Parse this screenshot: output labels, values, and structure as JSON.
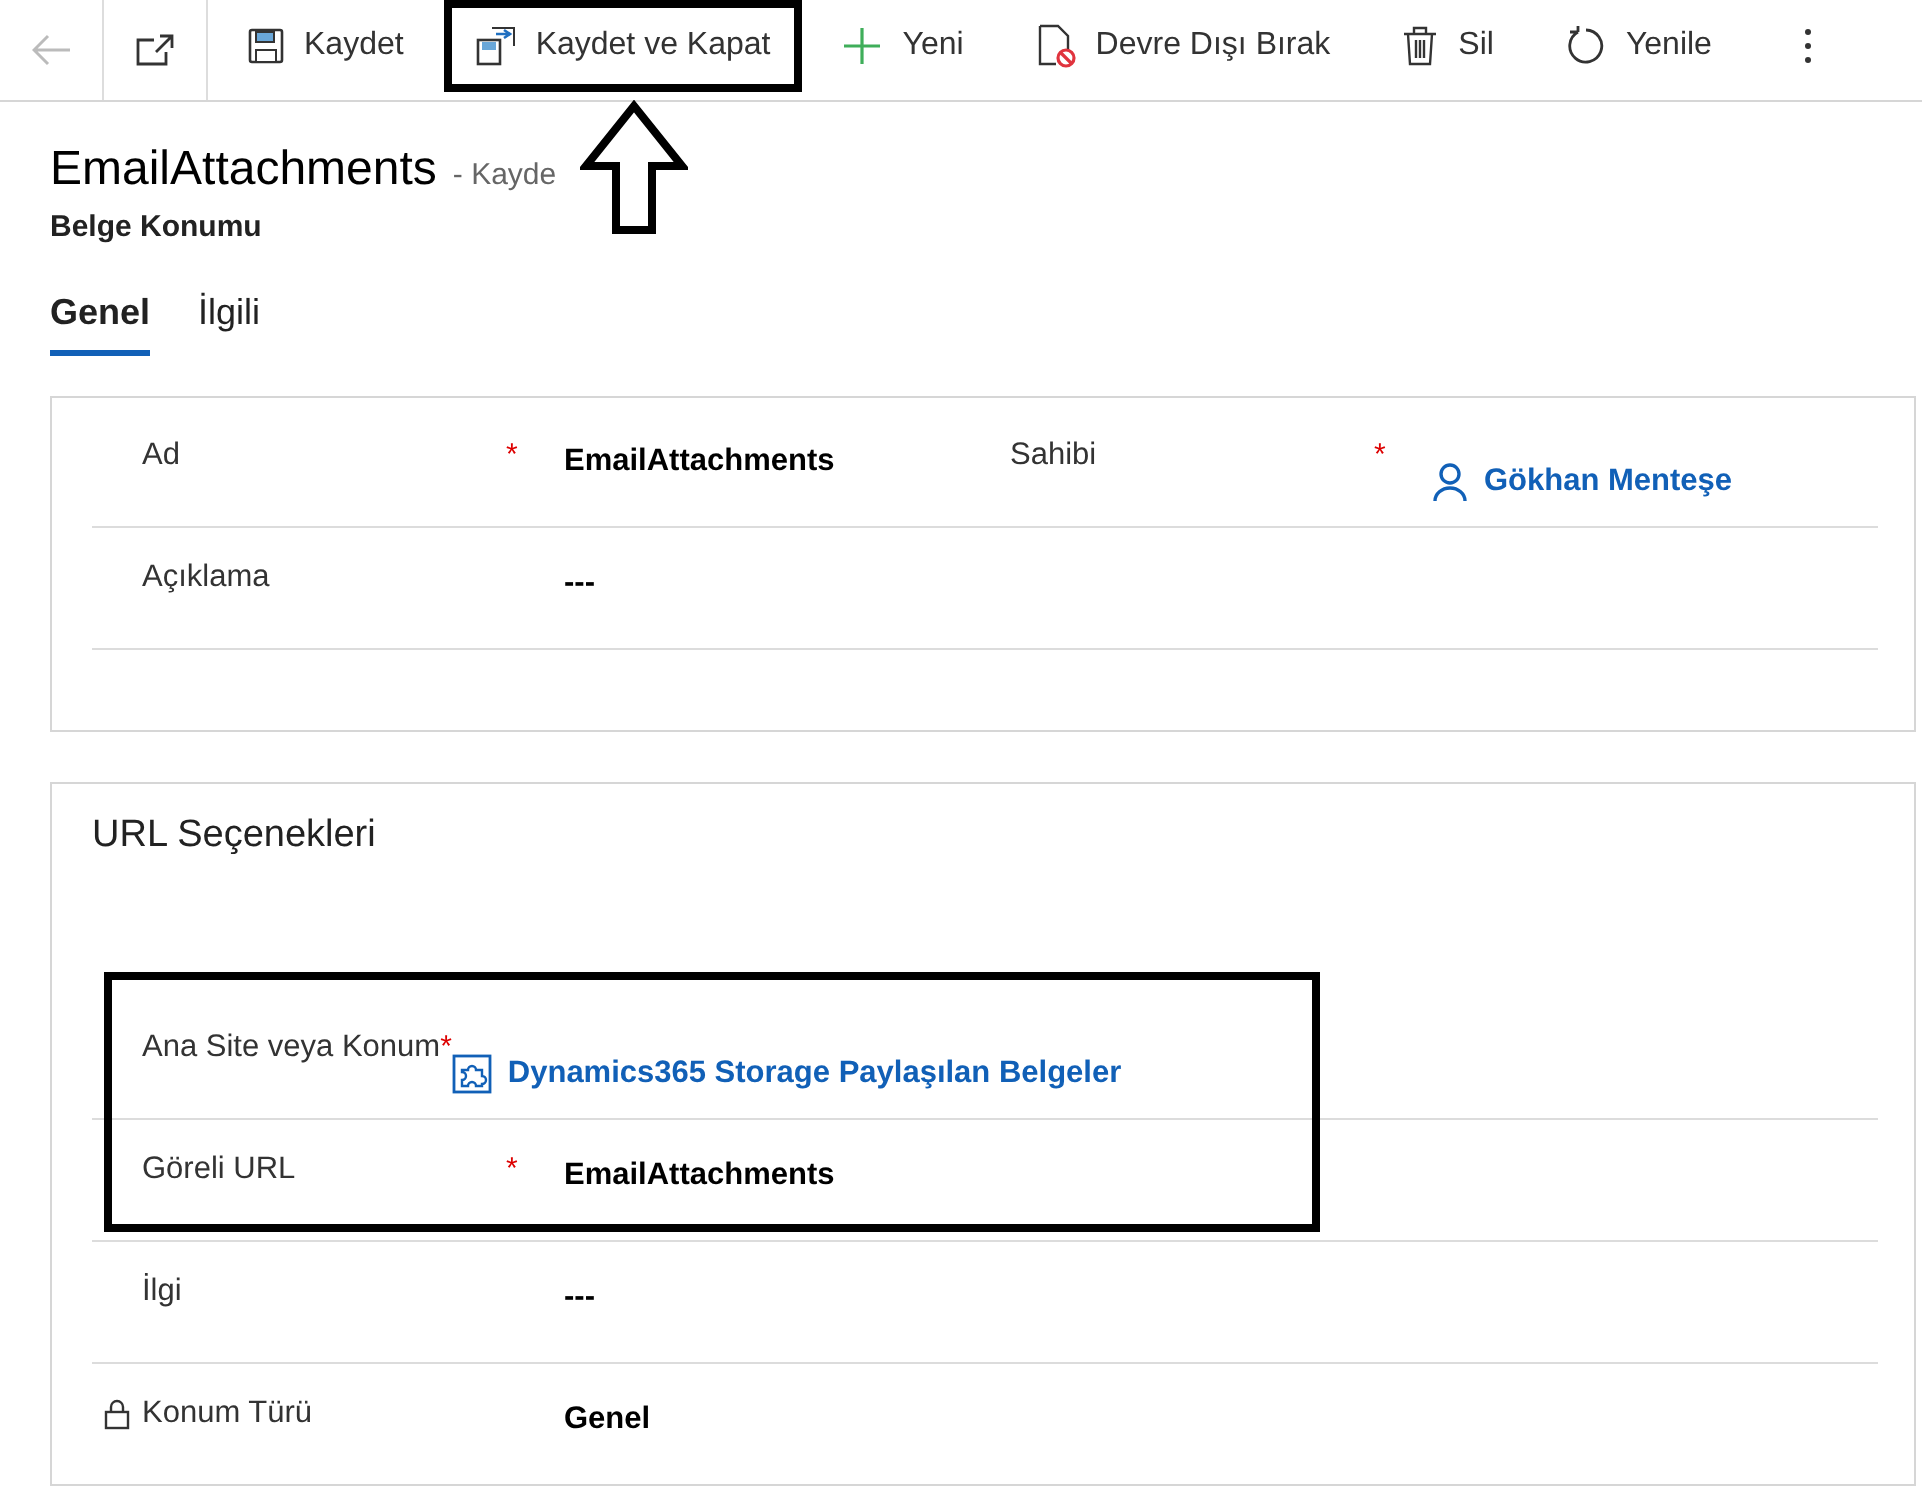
{
  "toolbar": [
    {
      "kind": "back",
      "disabled": true,
      "highlighted": false
    },
    {
      "kind": "popout",
      "disabled": false,
      "highlighted": false
    },
    {
      "kind": "save",
      "label": "Kaydet",
      "disabled": false,
      "highlighted": false
    },
    {
      "kind": "save-close",
      "label": "Kaydet ve Kapat",
      "disabled": false,
      "highlighted": true
    },
    {
      "kind": "new",
      "label": "Yeni",
      "disabled": false,
      "highlighted": false
    },
    {
      "kind": "deactivate",
      "label": "Devre Dışı Bırak",
      "disabled": false,
      "highlighted": false
    },
    {
      "kind": "delete",
      "label": "Sil",
      "disabled": false,
      "highlighted": false
    },
    {
      "kind": "refresh",
      "label": "Yenile",
      "disabled": false,
      "highlighted": false
    },
    {
      "kind": "more",
      "disabled": false,
      "highlighted": false
    }
  ],
  "record": {
    "title": "EmailAttachments",
    "status": "- Kayde",
    "entity": "Belge Konumu"
  },
  "tabs": [
    {
      "label": "Genel",
      "selected": true
    },
    {
      "label": "İlgili",
      "selected": false
    }
  ],
  "sections": [
    {
      "rows": [
        {
          "highlighted": false,
          "fields": [
            {
              "label": "Ad",
              "required": true,
              "required_mark": "*",
              "locked": false,
              "value": "EmailAttachments",
              "kind": "text"
            },
            {
              "label": "Sahibi",
              "required": true,
              "required_mark": "*",
              "locked": false,
              "value": "Gökhan Menteşe",
              "kind": "user-link"
            }
          ]
        },
        {
          "highlighted": false,
          "fields": [
            {
              "label": "Açıklama",
              "required": false,
              "locked": false,
              "value": "---",
              "kind": "text"
            }
          ]
        }
      ]
    },
    {
      "title": "URL Seçenekleri",
      "rows": [
        {
          "highlighted": true,
          "fields": [
            {
              "label": "Ana Site veya Konum",
              "required": true,
              "required_mark": "*",
              "locked": false,
              "value": "Dynamics365 Storage Paylaşılan Belgeler",
              "kind": "entity-link"
            }
          ]
        },
        {
          "highlighted": true,
          "fields": [
            {
              "label": "Göreli URL",
              "required": true,
              "required_mark": "*",
              "locked": false,
              "value": "EmailAttachments",
              "kind": "text"
            }
          ]
        },
        {
          "highlighted": false,
          "fields": [
            {
              "label": "İlgi",
              "required": false,
              "locked": false,
              "value": "---",
              "kind": "text"
            }
          ]
        },
        {
          "highlighted": false,
          "fields": [
            {
              "label": "Konum Türü",
              "required": false,
              "locked": true,
              "value": "Genel",
              "kind": "text"
            }
          ]
        }
      ]
    }
  ]
}
